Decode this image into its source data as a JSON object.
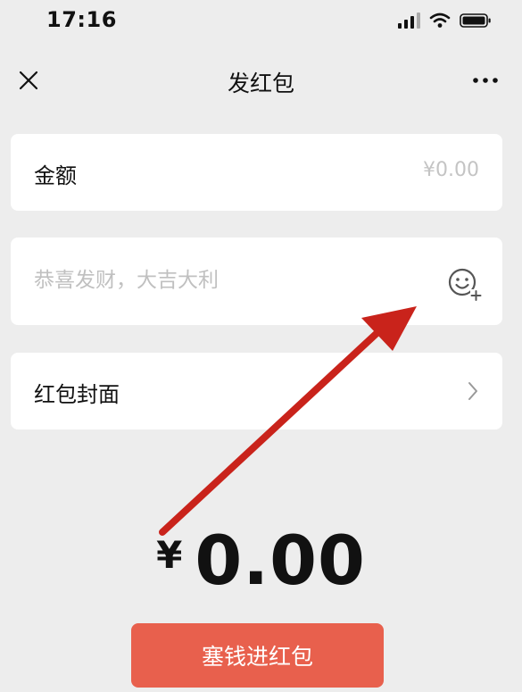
{
  "status_bar": {
    "time": "17:16"
  },
  "nav": {
    "title": "发红包"
  },
  "amount": {
    "label": "金额",
    "value": "¥0.00"
  },
  "greeting": {
    "placeholder": "恭喜发财，大吉大利"
  },
  "cover": {
    "label": "红包封面"
  },
  "total": {
    "currency": "¥",
    "value": "0.00"
  },
  "send_button": {
    "label": "塞钱进红包"
  },
  "colors": {
    "background": "#ededed",
    "card": "#ffffff",
    "button": "#e8604d",
    "annotation_arrow": "#c9231b"
  },
  "icons": [
    "signal-icon",
    "wifi-icon",
    "battery-icon",
    "close-icon",
    "more-icon",
    "emoji-add-icon",
    "chevron-right-icon",
    "annotation-arrow"
  ]
}
